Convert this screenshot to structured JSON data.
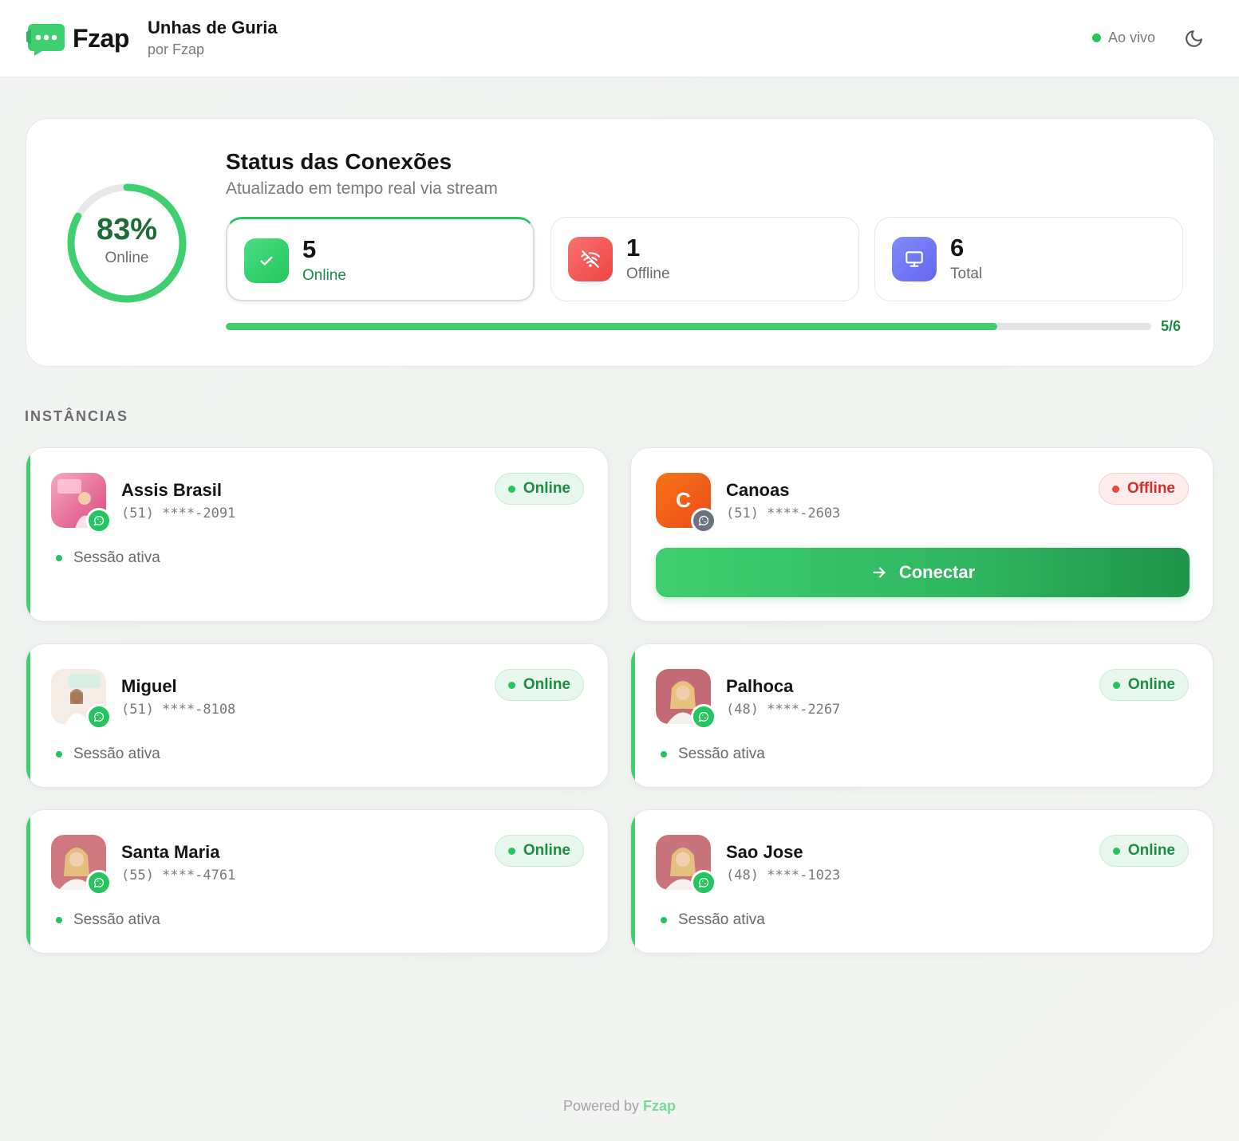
{
  "header": {
    "brand": "Fzap",
    "org_name": "Unhas de Guria",
    "org_sub": "por Fzap",
    "live_label": "Ao vivo",
    "theme_icon": "moon-icon"
  },
  "status": {
    "percent_label": "83%",
    "percent_caption": "Online",
    "percent_value": 0.83,
    "title": "Status das Conexões",
    "subtitle": "Atualizado em tempo real via stream",
    "online": {
      "count": "5",
      "label": "Online",
      "icon": "check-icon",
      "color": "#22c55e"
    },
    "offline": {
      "count": "1",
      "label": "Offline",
      "icon": "wifi-off-icon",
      "color": "#ef4444"
    },
    "total": {
      "count": "6",
      "label": "Total",
      "icon": "monitor-icon",
      "color": "#6366f1"
    },
    "progress_value": 0.8333,
    "progress_label": "5/6"
  },
  "section_title": "INSTÂNCIAS",
  "instances": [
    {
      "name": "Assis Brasil",
      "phone": "(51) ****-2091",
      "status": "Online",
      "session": "Sessão ativa"
    },
    {
      "name": "Canoas",
      "phone": "(51) ****-2603",
      "status": "Offline",
      "avatar_letter": "C",
      "action": "Conectar"
    },
    {
      "name": "Miguel",
      "phone": "(51) ****-8108",
      "status": "Online",
      "session": "Sessão ativa"
    },
    {
      "name": "Palhoca",
      "phone": "(48) ****-2267",
      "status": "Online",
      "session": "Sessão ativa"
    },
    {
      "name": "Santa Maria",
      "phone": "(55) ****-4761",
      "status": "Online",
      "session": "Sessão ativa"
    },
    {
      "name": "Sao Jose",
      "phone": "(48) ****-1023",
      "status": "Online",
      "session": "Sessão ativa"
    }
  ],
  "footer": {
    "prefix": "Powered by",
    "brand": "Fzap"
  },
  "colors": {
    "accent": "#22c55e",
    "danger": "#ef4444",
    "indigo": "#6366f1"
  }
}
